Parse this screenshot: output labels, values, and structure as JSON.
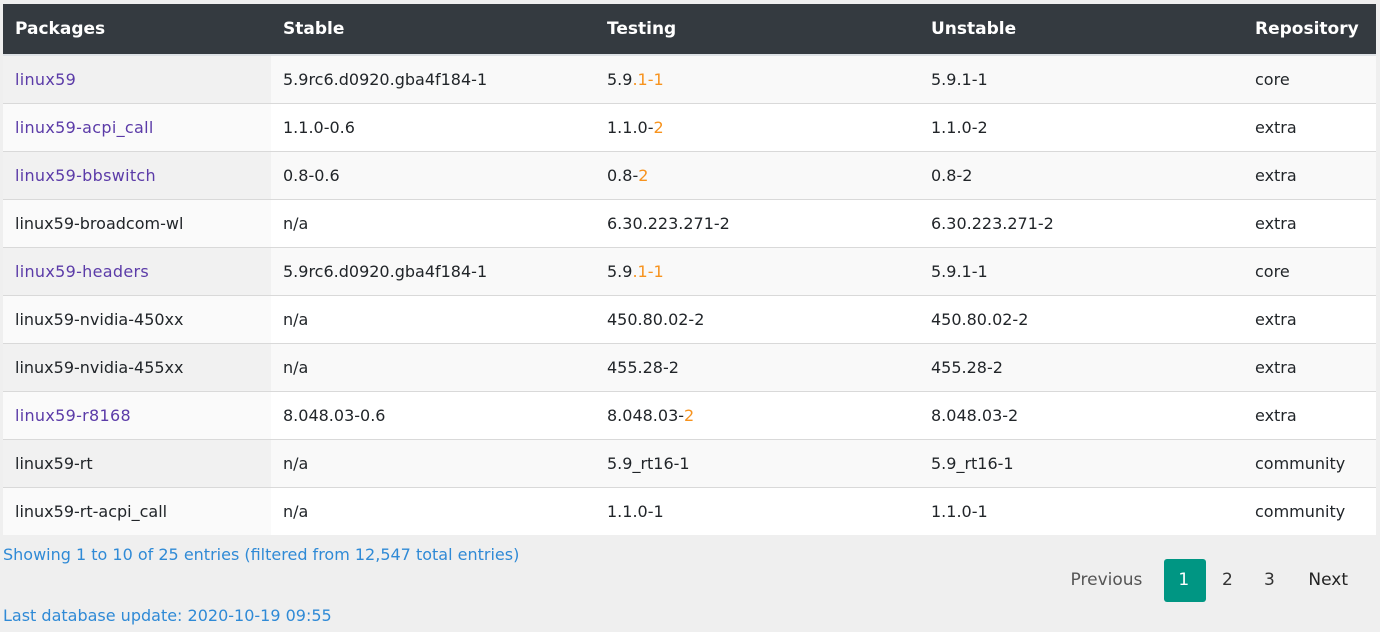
{
  "table": {
    "headers": [
      "Packages",
      "Stable",
      "Testing",
      "Unstable",
      "Repository"
    ],
    "rows": [
      {
        "package": "linux59",
        "is_link": true,
        "stable": "5.9rc6.d0920.gba4f184-1",
        "testing_base": "5.9",
        "testing_hl": ".1-1",
        "unstable": "5.9.1-1",
        "repository": "core"
      },
      {
        "package": "linux59-acpi_call",
        "is_link": true,
        "stable": "1.1.0-0.6",
        "testing_base": "1.1.0-",
        "testing_hl": "2",
        "unstable": "1.1.0-2",
        "repository": "extra"
      },
      {
        "package": "linux59-bbswitch",
        "is_link": true,
        "stable": "0.8-0.6",
        "testing_base": "0.8-",
        "testing_hl": "2",
        "unstable": "0.8-2",
        "repository": "extra"
      },
      {
        "package": "linux59-broadcom-wl",
        "is_link": false,
        "stable": "n/a",
        "testing_base": "6.30.223.271-2",
        "testing_hl": "",
        "unstable": "6.30.223.271-2",
        "repository": "extra"
      },
      {
        "package": "linux59-headers",
        "is_link": true,
        "stable": "5.9rc6.d0920.gba4f184-1",
        "testing_base": "5.9",
        "testing_hl": ".1-1",
        "unstable": "5.9.1-1",
        "repository": "core"
      },
      {
        "package": "linux59-nvidia-450xx",
        "is_link": false,
        "stable": "n/a",
        "testing_base": "450.80.02-2",
        "testing_hl": "",
        "unstable": "450.80.02-2",
        "repository": "extra"
      },
      {
        "package": "linux59-nvidia-455xx",
        "is_link": false,
        "stable": "n/a",
        "testing_base": "455.28-2",
        "testing_hl": "",
        "unstable": "455.28-2",
        "repository": "extra"
      },
      {
        "package": "linux59-r8168",
        "is_link": true,
        "stable": "8.048.03-0.6",
        "testing_base": "8.048.03-",
        "testing_hl": "2",
        "unstable": "8.048.03-2",
        "repository": "extra"
      },
      {
        "package": "linux59-rt",
        "is_link": false,
        "stable": "n/a",
        "testing_base": "5.9_rt16-1",
        "testing_hl": "",
        "unstable": "5.9_rt16-1",
        "repository": "community"
      },
      {
        "package": "linux59-rt-acpi_call",
        "is_link": false,
        "stable": "n/a",
        "testing_base": "1.1.0-1",
        "testing_hl": "",
        "unstable": "1.1.0-1",
        "repository": "community"
      }
    ]
  },
  "footer": {
    "info": "Showing 1 to 10 of 25 entries (filtered from 12,547 total entries)",
    "last_update": "Last database update: 2020-10-19 09:55"
  },
  "pagination": {
    "previous": "Previous",
    "pages": [
      "1",
      "2",
      "3"
    ],
    "active_page": "1",
    "next": "Next"
  },
  "colors": {
    "header_bg": "#343a40",
    "link": "#5b3ba8",
    "highlight": "#f7931e",
    "info_text": "#2f8ad6",
    "active_page": "#009683"
  }
}
